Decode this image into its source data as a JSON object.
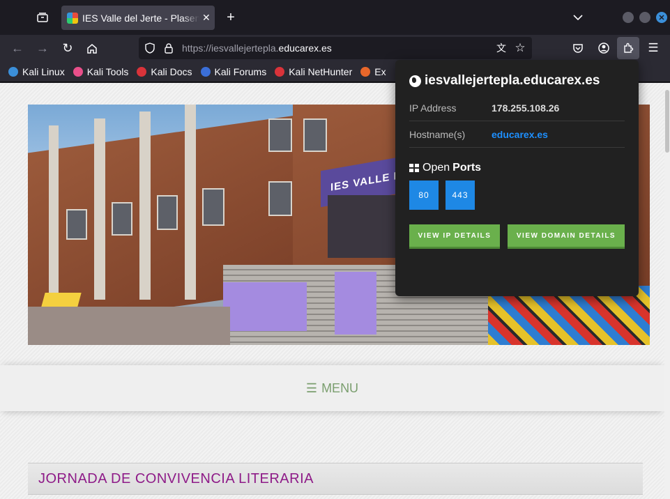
{
  "browser": {
    "tab_title": "IES Valle del Jerte - Plasencia",
    "url_prefix": "https://iesvallejertepla.",
    "url_domain": "educarex.es"
  },
  "bookmarks": [
    {
      "label": "Kali Linux",
      "color": "#3b8fd9"
    },
    {
      "label": "Kali Tools",
      "color": "#e94f8a"
    },
    {
      "label": "Kali Docs",
      "color": "#d9333a"
    },
    {
      "label": "Kali Forums",
      "color": "#3b6fd9"
    },
    {
      "label": "Kali NetHunter",
      "color": "#d9333a"
    },
    {
      "label": "Ex",
      "color": "#e8672a"
    }
  ],
  "page": {
    "menu_label": "MENU",
    "article_title": "JORNADA DE CONVIVENCIA LITERARIA",
    "hero_sign": "IES VALLE DE"
  },
  "popup": {
    "domain": "iesvallejertepla.educarex.es",
    "ip_label": "IP Address",
    "ip_value": "178.255.108.26",
    "host_label": "Hostname(s)",
    "host_value": "educarex.es",
    "ports_open": "Open",
    "ports_word": "Ports",
    "ports": [
      "80",
      "443"
    ],
    "btn_ip": "VIEW IP DETAILS",
    "btn_domain": "VIEW DOMAIN DETAILS"
  },
  "colors": {
    "accent_blue": "#1e88e5",
    "accent_green": "#6ab04c",
    "title_purple": "#8e1b88",
    "menu_green": "#7a9e6e"
  }
}
